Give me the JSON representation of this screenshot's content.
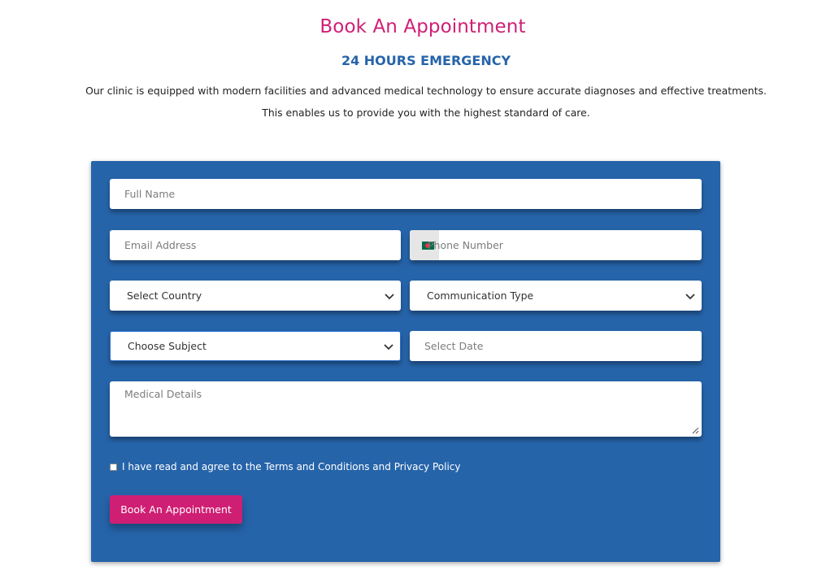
{
  "header": {
    "title": "Book An Appointment",
    "subtitle": "24 HOURS EMERGENCY",
    "intro_line1": "Our clinic is equipped with modern facilities and advanced medical technology to ensure accurate diagnoses and effective treatments.",
    "intro_line2": "This enables us to provide you with the highest standard of care."
  },
  "form": {
    "full_name_placeholder": "Full Name",
    "email_placeholder": "Email Address",
    "phone_placeholder": "Phone Number",
    "country_selected": "Select Country",
    "communication_selected": "Communication Type",
    "subject_selected": "Choose Subject",
    "date_placeholder": "Select Date",
    "medical_placeholder": "Medical Details",
    "terms_label": "I have read and agree to the Terms and Conditions and Privacy Policy",
    "submit_label": "Book An Appointment"
  },
  "colors": {
    "brand_pink": "#cf1f74",
    "brand_blue": "#2664aa"
  },
  "icons": {
    "chevron": "chevron-down-icon",
    "flag": "bangladesh-flag-icon",
    "resize": "resize-handle-icon"
  }
}
